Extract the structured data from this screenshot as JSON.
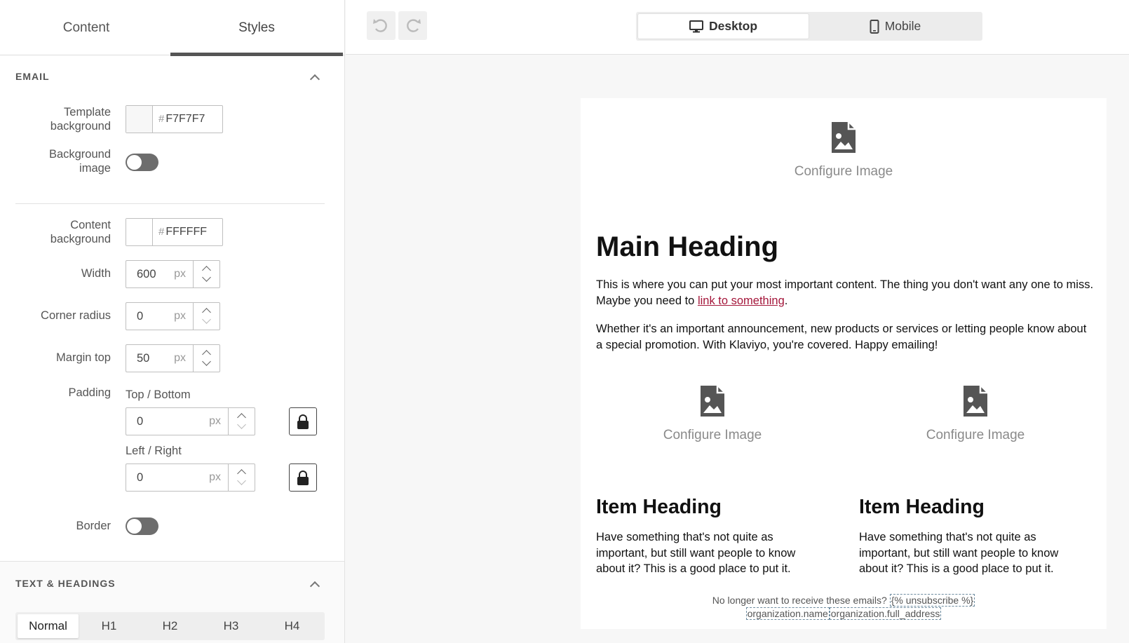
{
  "tabs": [
    {
      "label": "Content",
      "active": false
    },
    {
      "label": "Styles",
      "active": true
    }
  ],
  "email_section": {
    "title": "EMAIL",
    "template_background_label": "Template background",
    "template_background_value": "F7F7F7",
    "background_image_label": "Background image",
    "background_image_enabled": false,
    "content_background_label": "Content background",
    "content_background_value": "FFFFFF",
    "width_label": "Width",
    "width_value": "600",
    "corner_radius_label": "Corner radius",
    "corner_radius_value": "0",
    "margin_top_label": "Margin top",
    "margin_top_value": "50",
    "padding_label": "Padding",
    "top_bottom_label": "Top / Bottom",
    "top_bottom_value": "0",
    "left_right_label": "Left / Right",
    "left_right_value": "0",
    "border_label": "Border",
    "border_enabled": false,
    "unit": "px",
    "hash": "#"
  },
  "text_section": {
    "title": "TEXT & HEADINGS",
    "options": [
      "Normal",
      "H1",
      "H2",
      "H3",
      "H4"
    ],
    "active": "Normal"
  },
  "topbar": {
    "desktop_label": "Desktop",
    "mobile_label": "Mobile",
    "active_view": "Desktop"
  },
  "email_preview": {
    "image_placeholder": "Configure Image",
    "main_heading": "Main Heading",
    "para1_before": "This is where you can put your most important content. The thing you don't want any one to miss. Maybe you need to ",
    "para1_link": "link to something",
    "para1_after": ".",
    "para2": "Whether it's an important announcement, new products or services or letting people know about a special promotion. With Klaviyo, you're covered. Happy emailing!",
    "item_heading": "Item Heading",
    "item_text": "Have something that's not quite as important, but still want people to know about it? This is a good place to put it.",
    "footer_text": "No longer want to receive these emails?",
    "unsubscribe_token": "{% unsubscribe %}",
    "org_name_token": "organization.name",
    "org_address_token": "organization.full_address"
  },
  "colors": {
    "link": "#a4163a",
    "template_bg": "#F7F7F7",
    "content_bg": "#FFFFFF"
  }
}
